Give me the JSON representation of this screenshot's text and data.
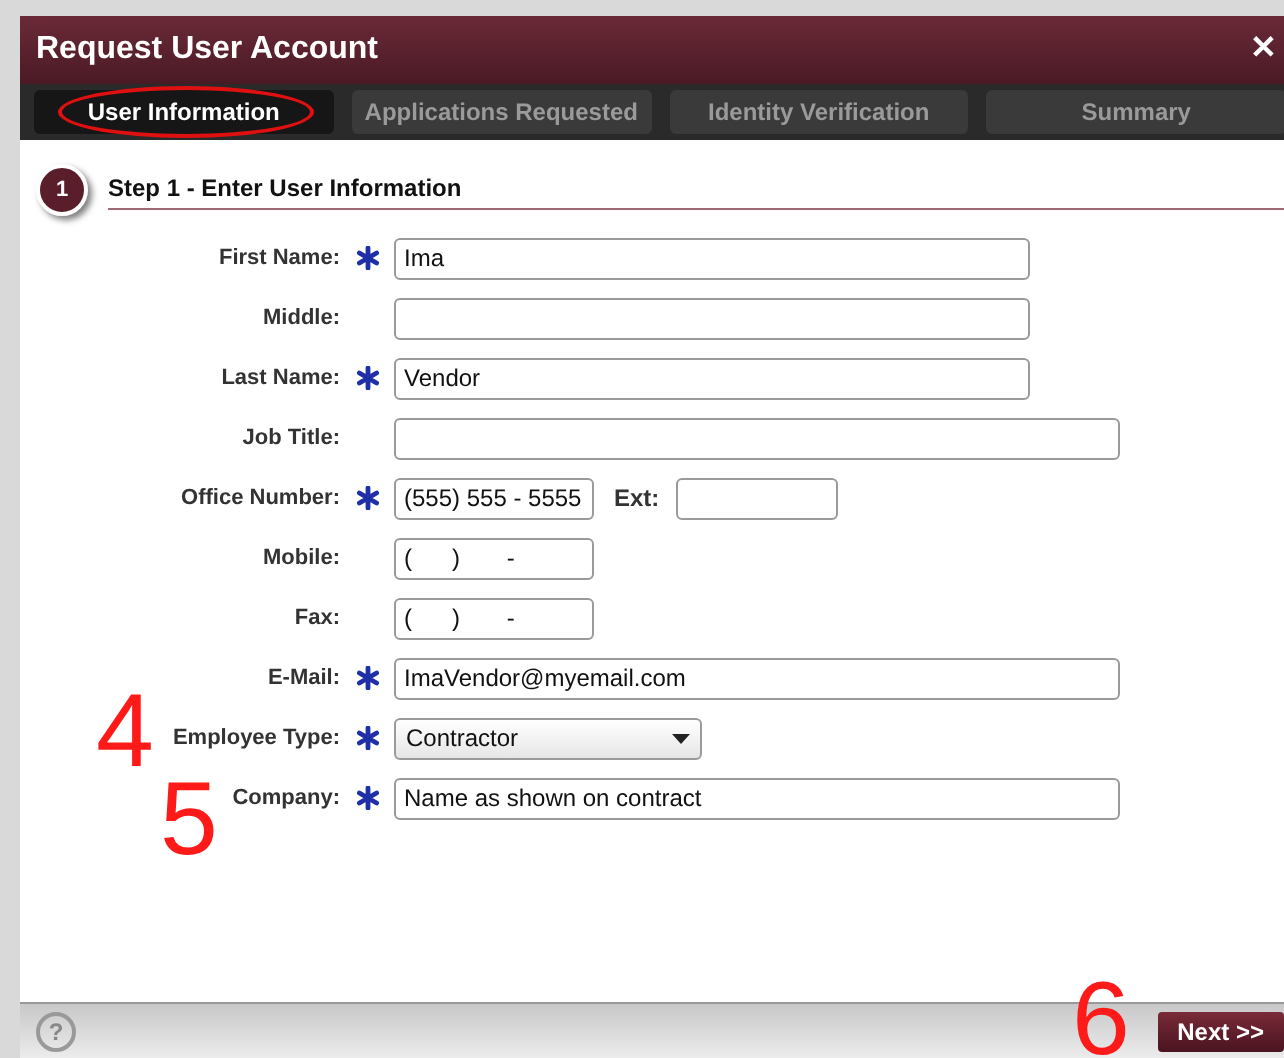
{
  "window": {
    "title": "Request User Account",
    "close": "✕"
  },
  "tabs": [
    {
      "label": "User Information",
      "selected": true,
      "circled": true
    },
    {
      "label": "Applications Requested",
      "selected": false,
      "circled": false
    },
    {
      "label": "Identity Verification",
      "selected": false,
      "circled": false
    },
    {
      "label": "Summary",
      "selected": false,
      "circled": false
    }
  ],
  "step": {
    "number": "1",
    "title": "Step 1 - Enter User Information"
  },
  "fields": [
    {
      "kind": "short_text",
      "label": "First Name:",
      "required": true,
      "value": "Ima"
    },
    {
      "kind": "short_text",
      "label": "Middle:",
      "required": false
    },
    {
      "kind": "short_text",
      "label": "Last Name:",
      "required": true,
      "value": "Vendor"
    },
    {
      "kind": "long_text",
      "label": "Job Title:",
      "required": false
    },
    {
      "kind": "phone",
      "label": "Office Number:",
      "required": true,
      "value": "(555) 555 - 5555",
      "ext_label": "Ext:"
    },
    {
      "kind": "phone",
      "label": "Mobile:",
      "required": false,
      "value": "(      )       -"
    },
    {
      "kind": "phone",
      "label": "Fax:",
      "required": false,
      "value": "(      )       -"
    },
    {
      "kind": "long_text",
      "label": "E-Mail:",
      "required": true,
      "value": "ImaVendor@myemail.com"
    },
    {
      "kind": "select",
      "label": "Employee Type:",
      "required": true,
      "value": "Contractor"
    },
    {
      "kind": "long_text",
      "label": "Company:",
      "required": true,
      "value": "Name as shown on contract"
    }
  ],
  "annotations": [
    "4",
    "5",
    "6"
  ],
  "footer": {
    "help": "?",
    "next": "Next >>"
  }
}
